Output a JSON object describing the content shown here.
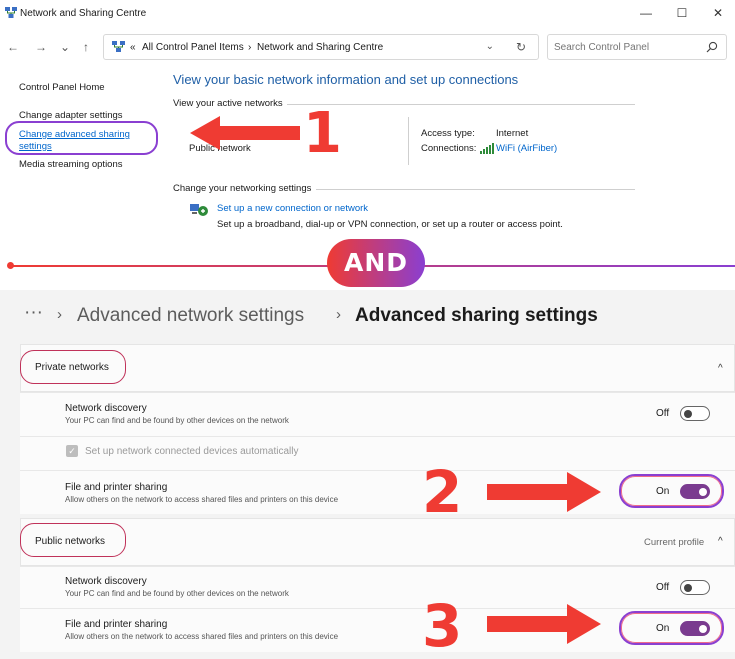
{
  "control_panel": {
    "window_title": "Network and Sharing Centre",
    "window_controls": {
      "minimize": "—",
      "maximize": "☐",
      "close": "✕"
    },
    "nav": {
      "back": "←",
      "forward": "→",
      "history": "⌄",
      "up": "↑"
    },
    "address": {
      "prefix": "«",
      "part1": "All Control Panel Items",
      "separator": "›",
      "part2": "Network and Sharing Centre",
      "dropdown": "⌄",
      "refresh": "↻"
    },
    "search": {
      "placeholder": "Search Control Panel"
    },
    "sidebar": {
      "home": "Control Panel Home",
      "adapter": "Change adapter settings",
      "advanced_line1": "Change advanced sharing",
      "advanced_line2": "settings",
      "media": "Media streaming options"
    },
    "headline": "View your basic network information and set up connections",
    "active_networks_heading": "View your active networks",
    "network_type_partial": "Public network",
    "access_type_label": "Access type:",
    "access_type_value": "Internet",
    "connections_label": "Connections:",
    "connections_value": "WiFi (AirFiber)",
    "change_settings_heading": "Change your networking settings",
    "setup_link": "Set up a new connection or network",
    "setup_desc": "Set up a broadband, dial-up or VPN connection, or set up a router or access point."
  },
  "annotations": {
    "step1": "1",
    "and_badge": "AND",
    "step2": "2",
    "step3": "3",
    "accent_red": "#ef3b33",
    "accent_purple": "#8a3fd1"
  },
  "settings": {
    "breadcrumb": {
      "more": "···",
      "sep": "›",
      "parent": "Advanced network settings",
      "current": "Advanced sharing settings"
    },
    "private": {
      "label": "Private networks",
      "collapse": "^",
      "discovery_title": "Network discovery",
      "discovery_sub": "Your PC can find and be found by other devices on the network",
      "discovery_state": "Off",
      "auto_setup": "Set up network connected devices automatically",
      "sharing_title": "File and printer sharing",
      "sharing_sub": "Allow others on the network to access shared files and printers on this device",
      "sharing_state": "On"
    },
    "public": {
      "label": "Public networks",
      "profile": "Current profile",
      "collapse": "^",
      "discovery_title": "Network discovery",
      "discovery_sub": "Your PC can find and be found by other devices on the network",
      "discovery_state": "Off",
      "sharing_title": "File and printer sharing",
      "sharing_sub": "Allow others on the network to access shared files and printers on this device",
      "sharing_state": "On"
    },
    "toggle_on_color": "#7a3b8f"
  }
}
